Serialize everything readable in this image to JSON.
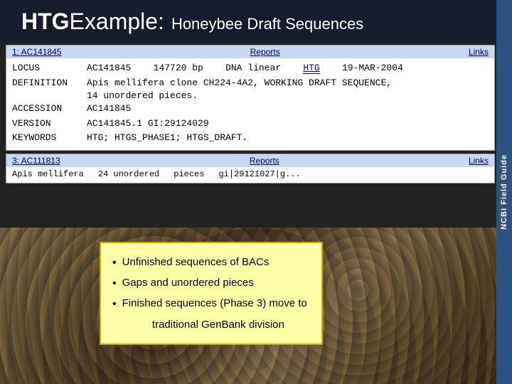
{
  "page": {
    "title_htg": "HTG",
    "title_example": " Example:",
    "title_subtitle": "Honeybee Draft Sequences"
  },
  "ncbi": {
    "label": "NCBI Field Guide"
  },
  "record1": {
    "header": {
      "left": "1: AC141845",
      "middle": "Reports",
      "right": "Links"
    },
    "locus_label": "LOCUS",
    "locus_value": "AC141845",
    "locus_bp": "147720 bp",
    "locus_type": "DNA linear",
    "locus_htg": "HTG",
    "locus_date": "19-MAR-2004",
    "definition_label": "DEFINITION",
    "definition_value": "Apis mellifera clone CH224-4A2, WORKING DRAFT SEQUENCE,",
    "definition_cont": "14 unordered pieces.",
    "accession_label": "ACCESSION",
    "accession_value": "AC141845",
    "version_label": "VERSION",
    "version_value": "AC141845.1 GI:29124029",
    "keywords_label": "KEYWORDS",
    "keywords_value": "HTG; HTGS_PHASE1; HTGS_DRAFT."
  },
  "record2": {
    "header": {
      "left": "3: AC111813",
      "middle": "Reports",
      "right": "Links"
    },
    "col1": "Apis mellifera",
    "col2": "24 unordered",
    "col3": "pieces",
    "col4": "gi|29121027|g..."
  },
  "popup": {
    "item1": "Unfinished sequences of BACs",
    "item2": "Gaps and unordered pieces",
    "item3": "Finished sequences (Phase 3) move to",
    "item4": "traditional GenBank division"
  }
}
